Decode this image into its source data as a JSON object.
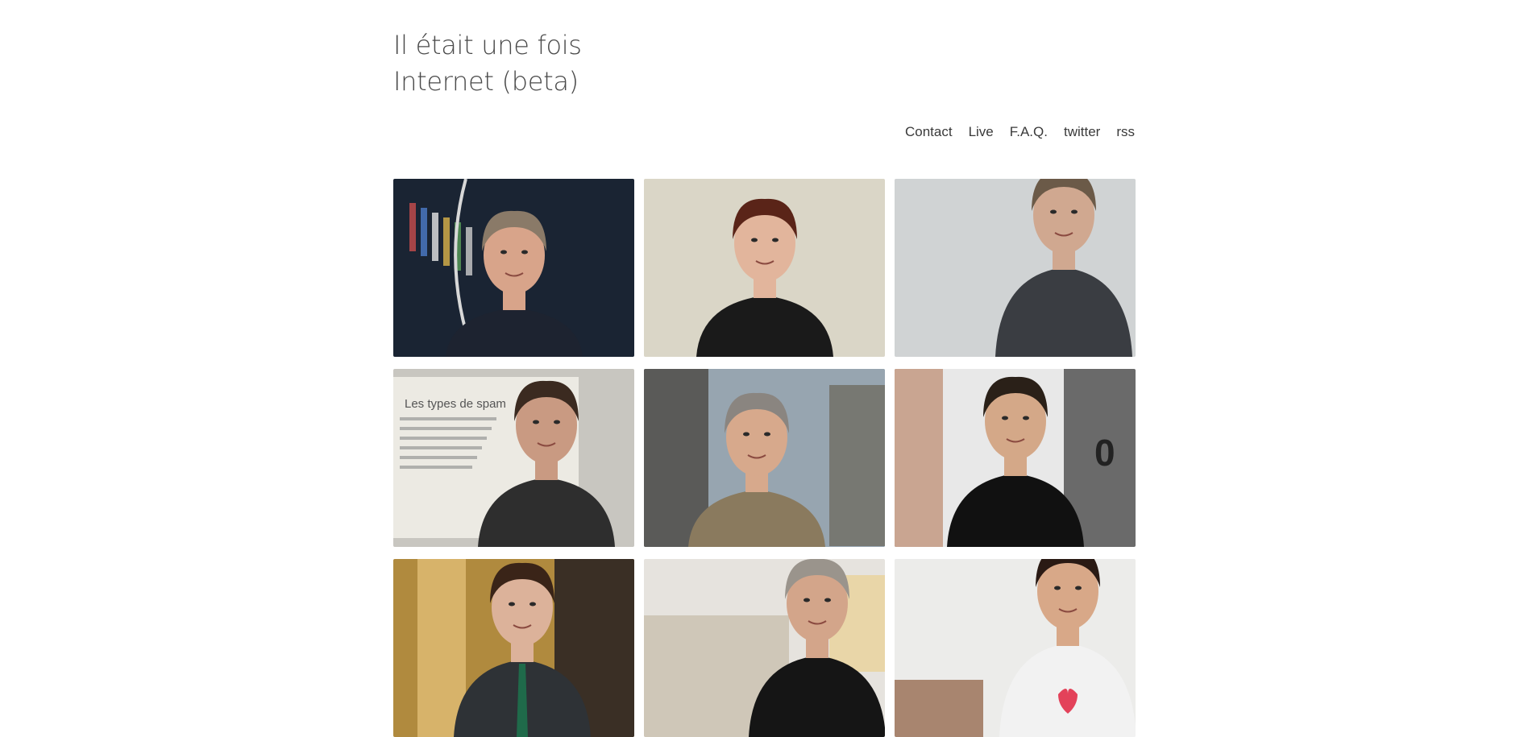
{
  "site": {
    "title": "Il était une fois\nInternet (beta)"
  },
  "nav": {
    "items": [
      {
        "label": "Contact"
      },
      {
        "label": "Live"
      },
      {
        "label": "F.A.Q."
      },
      {
        "label": "twitter"
      },
      {
        "label": "rss"
      }
    ]
  },
  "gallery": {
    "tiles": [
      {
        "name": "portrait-man-suit-bookshelf",
        "bg": "#1a2433",
        "accent": "#2b3a55",
        "skin": "#d8a48a",
        "hair": "#8a7a68",
        "shirt": "#1d2330"
      },
      {
        "name": "portrait-woman-glasses",
        "bg": "#e4e0d4",
        "accent": "#c9c3b0",
        "skin": "#e2b59c",
        "hair": "#5a2418",
        "shirt": "#1a1a1a"
      },
      {
        "name": "portrait-speaker-microphone-grey-tshirt",
        "bg": "#d8dadb",
        "accent": "#c4c7c9",
        "skin": "#d0a890",
        "hair": "#6b5a48",
        "shirt": "#3a3d42"
      },
      {
        "name": "portrait-speaker-spam-slide",
        "bg": "#c8c6c0",
        "accent": "#eceae3",
        "skin": "#c99a82",
        "hair": "#3b2a20",
        "shirt": "#2e2e2e",
        "slide_text": "Les types de spam"
      },
      {
        "name": "portrait-man-grey-hair-outdoors",
        "bg": "#7d8a8f",
        "accent": "#a9b8c6",
        "skin": "#d7a98c",
        "hair": "#8a8580",
        "shirt": "#8a7a5e"
      },
      {
        "name": "portrait-man-black-shirt-gesturing",
        "bg": "#6a6a6a",
        "accent": "#e8e8e8",
        "skin": "#d4a888",
        "hair": "#2a2018",
        "shirt": "#111111",
        "sign_text": "0"
      },
      {
        "name": "portrait-man-beard-green-tie",
        "bg": "#b08a3e",
        "accent": "#3a2f25",
        "skin": "#dcb29a",
        "hair": "#3a2418",
        "shirt": "#2e3236"
      },
      {
        "name": "portrait-man-leaning-fence",
        "bg": "#e6e3de",
        "accent": "#cfc7b8",
        "skin": "#d3a58a",
        "hair": "#9a948c",
        "shirt": "#151515"
      },
      {
        "name": "portrait-man-nerds-tshirt",
        "bg": "#ececea",
        "accent": "#8b5a3a",
        "skin": "#d8a888",
        "hair": "#2a1a14",
        "shirt": "#f2f2f2"
      }
    ]
  }
}
